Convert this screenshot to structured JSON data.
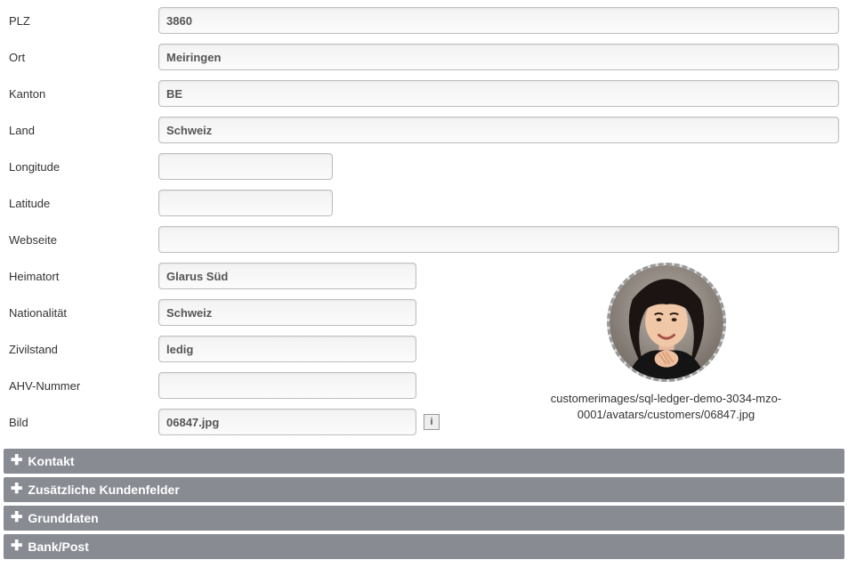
{
  "fields": {
    "plz": {
      "label": "PLZ",
      "value": "3860"
    },
    "ort": {
      "label": "Ort",
      "value": "Meiringen"
    },
    "kanton": {
      "label": "Kanton",
      "value": "BE"
    },
    "land": {
      "label": "Land",
      "value": "Schweiz"
    },
    "longitude": {
      "label": "Longitude",
      "value": ""
    },
    "latitude": {
      "label": "Latitude",
      "value": ""
    },
    "webseite": {
      "label": "Webseite",
      "value": ""
    },
    "heimatort": {
      "label": "Heimatort",
      "value": "Glarus Süd"
    },
    "nationalitaet": {
      "label": "Nationalität",
      "value": "Schweiz"
    },
    "zivilstand": {
      "label": "Zivilstand",
      "value": "ledig"
    },
    "ahv": {
      "label": "AHV-Nummer",
      "value": ""
    },
    "bild": {
      "label": "Bild",
      "value": "06847.jpg"
    }
  },
  "avatar_caption": "customerimages/sql-ledger-demo-3034-mzo-0001/avatars/customers/06847.jpg",
  "info_icon": "i",
  "accordion": {
    "kontakt": "Kontakt",
    "extra": "Zusätzliche Kundenfelder",
    "grund": "Grunddaten",
    "bank": "Bank/Post"
  }
}
